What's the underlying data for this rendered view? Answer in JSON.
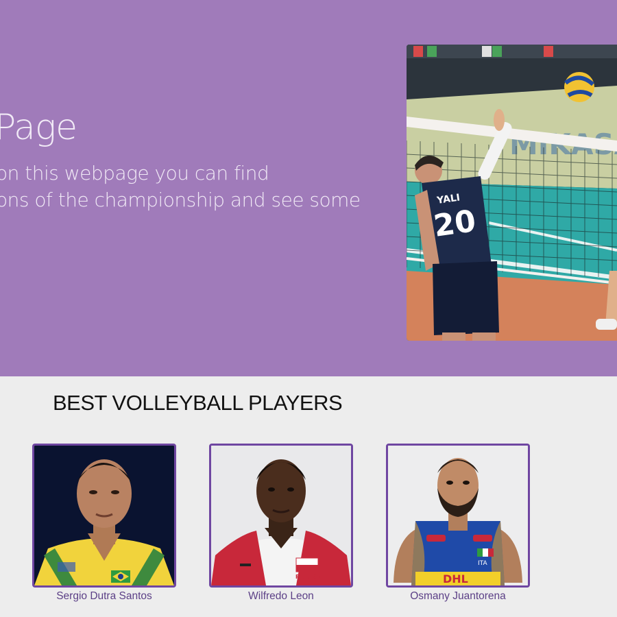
{
  "hero": {
    "title": "Page",
    "text_line1": "on this webpage you can find",
    "text_line2": "ons of the championship and see some",
    "photo_jersey_name": "YALI",
    "photo_jersey_number": "20",
    "photo_banner_text": "MIKASA"
  },
  "players": {
    "heading": "BEST VOLLEYBALL PLAYERS",
    "items": [
      {
        "name": "Sergio Dutra Santos"
      },
      {
        "name": "Wilfredo Leon",
        "jersey_text": "POLSKA"
      },
      {
        "name": "Osmany Juantorena",
        "jersey_text": "ITA"
      }
    ]
  },
  "colors": {
    "hero_bg": "#a07bba",
    "accent": "#6f46a1",
    "page_bg": "#ededed"
  }
}
